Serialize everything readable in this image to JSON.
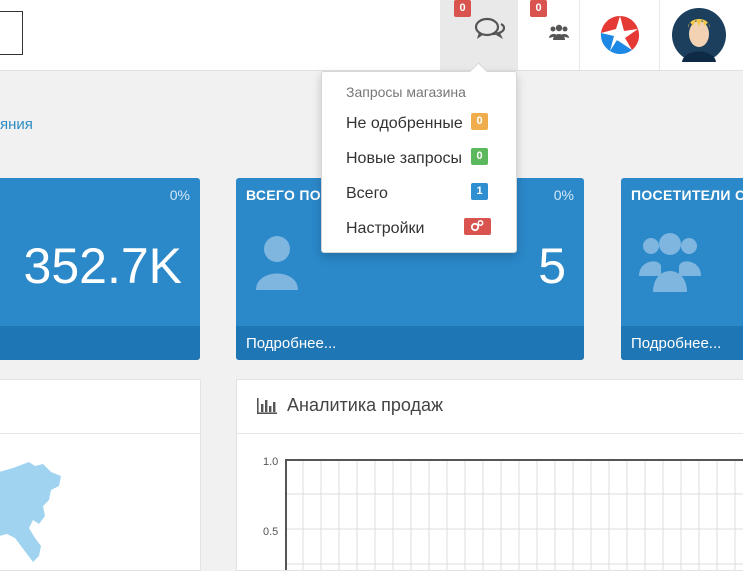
{
  "header": {
    "messages_badge": "0",
    "users_badge": "0"
  },
  "breadcrumb": {
    "link_text": "яния"
  },
  "panels": [
    {
      "title": "",
      "percent": "0%",
      "value": "352.7K",
      "footer": ""
    },
    {
      "title": "ВСЕГО ПО",
      "percent": "0%",
      "value": "5",
      "footer": "Подробнее..."
    },
    {
      "title": "ПОСЕТИТЕЛИ С",
      "percent": "",
      "value": "",
      "footer": "Подробнее..."
    }
  ],
  "sales_box": {
    "title": "Аналитика продаж",
    "y_ticks": [
      "1.0",
      "0.5"
    ]
  },
  "dropdown": {
    "header": "Запросы магазина",
    "items": [
      {
        "label": "Не одобренные",
        "badge": "0",
        "badge_color": "#f0ad4e"
      },
      {
        "label": "Новые запросы",
        "badge": "0",
        "badge_color": "#5cb85c"
      },
      {
        "label": "Всего",
        "badge": "1",
        "badge_color": "#2f8fd0"
      },
      {
        "label": "Настройки",
        "badge_icon": "gears-icon",
        "badge_color": "#d9534f"
      }
    ]
  },
  "colors": {
    "panel_blue": "#2b88c9",
    "panel_footer": "#1f76b4",
    "link": "#2b8cc4"
  }
}
